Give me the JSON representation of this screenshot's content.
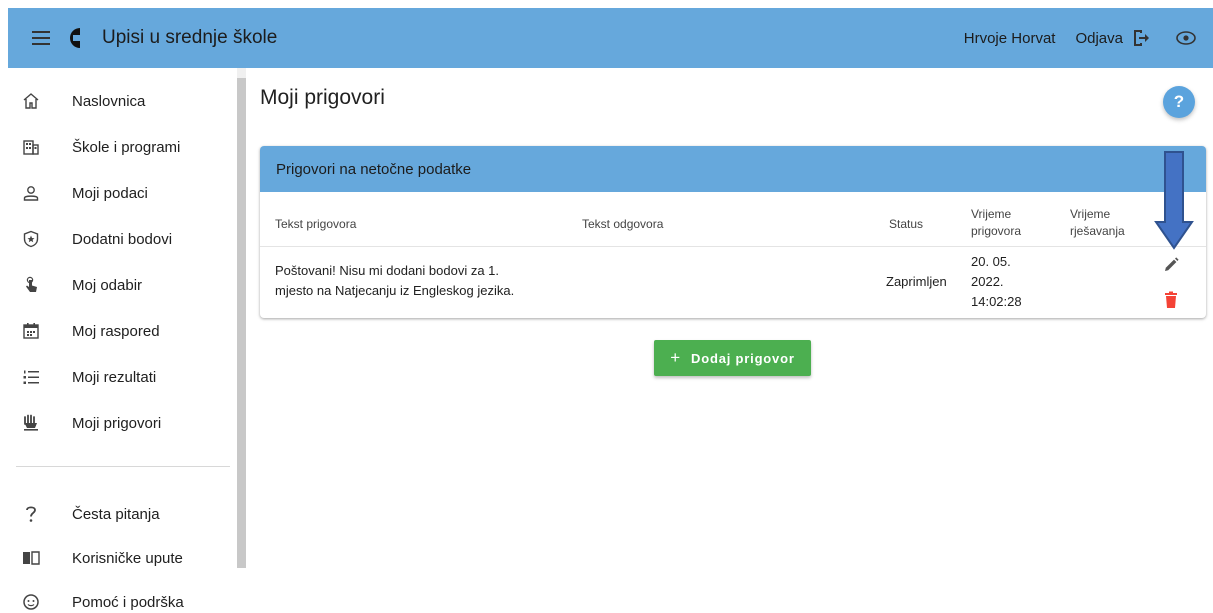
{
  "header": {
    "app_title": "Upisi u srednje škole",
    "user_name": "Hrvoje Horvat",
    "logout_label": "Odjava",
    "menu_icon": "hamburger-menu-icon",
    "logo_icon": "logo-icon",
    "eye_icon": "eye-icon",
    "logout_icon": "logout-icon",
    "bar_color": "#66a8dc"
  },
  "sidebar": {
    "items": [
      {
        "label": "Naslovnica",
        "icon": "home-icon"
      },
      {
        "label": "Škole i programi",
        "icon": "building-icon"
      },
      {
        "label": "Moji podaci",
        "icon": "person-icon"
      },
      {
        "label": "Dodatni bodovi",
        "icon": "star-shield-icon"
      },
      {
        "label": "Moj odabir",
        "icon": "touch-icon"
      },
      {
        "label": "Moj raspored",
        "icon": "calendar-icon"
      },
      {
        "label": "Moji rezultati",
        "icon": "list-numbered-icon"
      },
      {
        "label": "Moji prigovori",
        "icon": "hand-icon"
      }
    ],
    "bottom_items": [
      {
        "label": "Česta pitanja",
        "icon": "question-icon"
      },
      {
        "label": "Korisničke upute",
        "icon": "book-icon"
      },
      {
        "label": "Pomoć i podrška",
        "icon": "support-icon"
      }
    ]
  },
  "main": {
    "title": "Moji prigovori",
    "help_label": "?",
    "card": {
      "title": "Prigovori na netočne podatke",
      "columns": {
        "text": "Tekst prigovora",
        "answer": "Tekst odgovora",
        "status": "Status",
        "time_1": "Vrijeme",
        "time_2": "prigovora",
        "resolve_1": "Vrijeme",
        "resolve_2": "rješavanja"
      },
      "rows": [
        {
          "text_line1": "Poštovani! Nisu mi dodani bodovi za 1.",
          "text_line2": "mjesto na Natjecanju iz Engleskog jezika.",
          "answer": "",
          "status": "Zaprimljen",
          "time_line1": "20. 05.",
          "time_line2": "2022.",
          "time_line3": "14:02:28",
          "resolve_time": ""
        }
      ]
    },
    "add_button": "Dodaj prigovor",
    "colors": {
      "add_button": "#4caf50",
      "delete_icon": "#f44336",
      "edit_icon": "#555555",
      "annotation_arrow": "#4472c4"
    }
  }
}
